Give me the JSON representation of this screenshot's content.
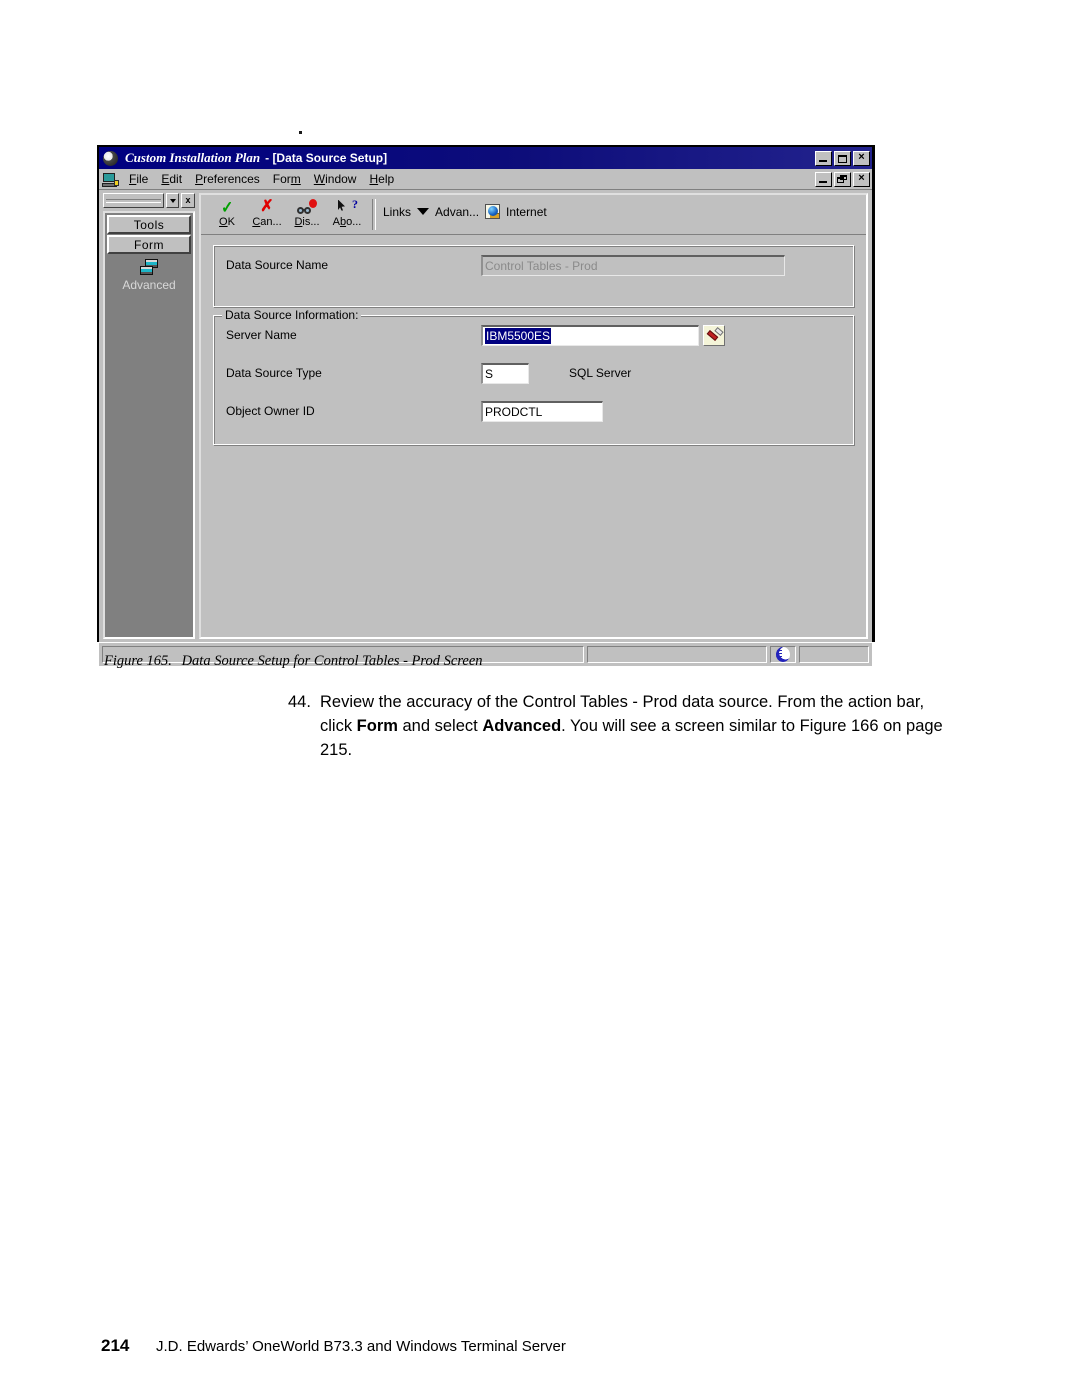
{
  "window": {
    "title_app": "Custom Installation Plan",
    "title_doc": "- [Data Source Setup]",
    "logo_icon": "sphere-logo-icon",
    "buttons": {
      "minimize": "minimize-button",
      "maximize": "maximize-button",
      "restore": "restore-button",
      "close": "×"
    }
  },
  "menubar": {
    "icon": "terminal-icon",
    "items": [
      {
        "label": "File",
        "accel": "F"
      },
      {
        "label": "Edit",
        "accel": "E"
      },
      {
        "label": "Preferences",
        "accel": "P"
      },
      {
        "label": "Form",
        "accel": "m"
      },
      {
        "label": "Window",
        "accel": "W"
      },
      {
        "label": "Help",
        "accel": "H"
      }
    ]
  },
  "sidebar": {
    "combo_value": "",
    "close_label": "x",
    "buttons": [
      {
        "label": "Tools"
      },
      {
        "label": "Form"
      }
    ],
    "entries": [
      {
        "label": "Advanced",
        "icon": "stacked-forms-icon"
      }
    ]
  },
  "toolbar": {
    "buttons": [
      {
        "label": "OK",
        "accel": "O",
        "icon": "check-icon"
      },
      {
        "label": "Can...",
        "accel": "C",
        "icon": "x-icon"
      },
      {
        "label": "Dis...",
        "accel": "D",
        "icon": "goggles-balloon-icon"
      },
      {
        "label": "Abo...",
        "accel": "b",
        "icon": "cursor-question-icon"
      }
    ],
    "links_label": "Links",
    "advanced_label": "Advan...",
    "internet_label": "Internet",
    "internet_icon": "internet-globe-icon",
    "dropdown_icon": "chevron-down-icon"
  },
  "form": {
    "group1": {
      "rows": [
        {
          "label": "Data Source Name",
          "value": "Control Tables - Prod",
          "disabled": true
        }
      ]
    },
    "group2": {
      "legend": "Data Source Information:",
      "server_name": {
        "label": "Server Name",
        "value": "IBM5500ES",
        "selected": true,
        "picker_icon": "flashlight-visual-assist-icon"
      },
      "data_source_type": {
        "label": "Data Source Type",
        "value": "S",
        "description": "SQL Server"
      },
      "object_owner_id": {
        "label": "Object Owner ID",
        "value": "PRODCTL"
      }
    }
  },
  "statusbar": {
    "pane_left": "",
    "pane_mid": "",
    "globe_icon": "status-globe-icon",
    "pane_end": ""
  },
  "caption": {
    "number": "Figure 165.",
    "text": "Data Source Setup for Control Tables - Prod Screen"
  },
  "step": {
    "number": "44.",
    "part1": "Review the accuracy of the Control Tables - Prod data source. From the action bar, click ",
    "bold1": "Form",
    "part2": " and select ",
    "bold2": "Advanced",
    "part3": ". You will see a screen similar to Figure 166 on page 215."
  },
  "footer": {
    "page_number": "214",
    "text": "J.D. Edwards’ OneWorld B73.3 and Windows Terminal Server"
  },
  "colors": {
    "titlebar": "#000080",
    "chrome": "#c0c0c0",
    "sidebar_panel": "#808080",
    "selection": "#000080",
    "ok_check": "#00a000",
    "cancel_x": "#e00000"
  }
}
